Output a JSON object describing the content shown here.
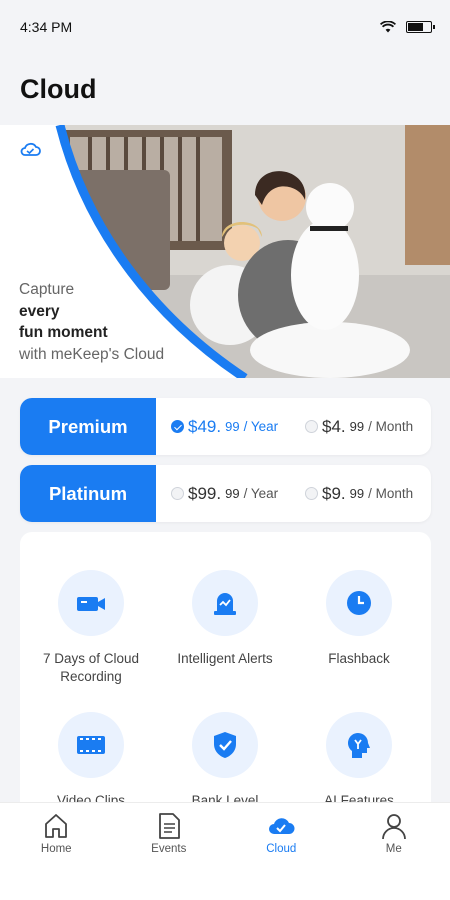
{
  "status_bar": {
    "time": "4:34 PM"
  },
  "header": {
    "title": "Cloud"
  },
  "hero": {
    "line1": "Capture",
    "line2": "every",
    "line3": "fun moment",
    "line4": "with meKeep's Cloud"
  },
  "plans": [
    {
      "name": "Premium",
      "yearly": {
        "dollars": "$49.",
        "cents": "99",
        "unit": "/ Year",
        "selected": true
      },
      "monthly": {
        "dollars": "$4.",
        "cents": "99",
        "unit": "/ Month",
        "selected": false
      }
    },
    {
      "name": "Platinum",
      "yearly": {
        "dollars": "$99.",
        "cents": "99",
        "unit": "/ Year",
        "selected": false
      },
      "monthly": {
        "dollars": "$9.",
        "cents": "99",
        "unit": "/ Month",
        "selected": false
      }
    }
  ],
  "features": [
    {
      "label": "7 Days of Cloud Recording",
      "icon": "camera-icon"
    },
    {
      "label": "Intelligent Alerts",
      "icon": "alert-icon"
    },
    {
      "label": "Flashback",
      "icon": "clock-icon"
    },
    {
      "label": "Video Clips",
      "icon": "film-icon"
    },
    {
      "label": "Bank Level",
      "icon": "shield-icon"
    },
    {
      "label": "AI Features",
      "icon": "ai-head-icon"
    }
  ],
  "tabs": [
    {
      "label": "Home",
      "active": false
    },
    {
      "label": "Events",
      "active": false
    },
    {
      "label": "Cloud",
      "active": true
    },
    {
      "label": "Me",
      "active": false
    }
  ],
  "colors": {
    "accent": "#1a7cf2",
    "background": "#f3f4f7",
    "icon_bg": "#eaf2fe"
  }
}
